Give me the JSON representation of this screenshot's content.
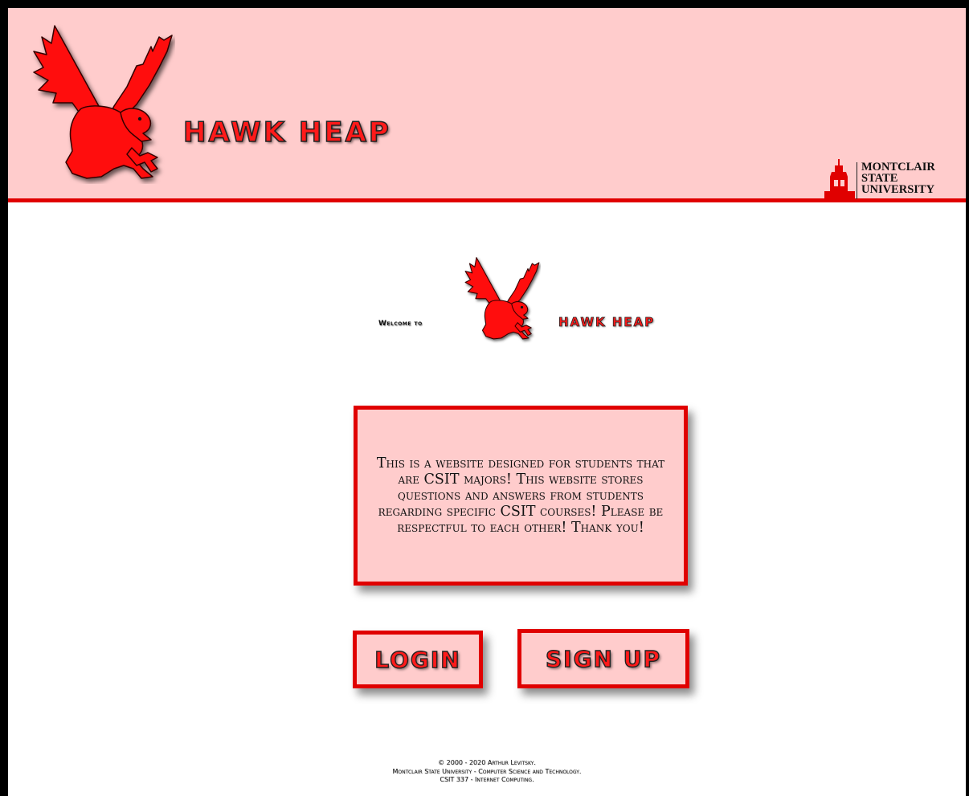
{
  "header": {
    "site_title": "HAWK HEAP",
    "university_logo": {
      "line1": "MONTCLAIR",
      "line2": "STATE",
      "line3": "UNIVERSITY"
    }
  },
  "welcome": {
    "prefix": "Welcome to",
    "site_title": "HAWK HEAP"
  },
  "info": {
    "text": "This is a website designed for students that are CSIT majors! This website stores questions and answers from students regarding specific CSIT courses! Please be respectful to each other! Thank you!"
  },
  "buttons": {
    "login_label": "LOGIN",
    "signup_label": "SIGN UP"
  },
  "footer": {
    "line1": "© 2000 - 2020 Arthur Levitsky.",
    "line2": "Montclair State University - Computer Science and Technology.",
    "line3": "CSIT 337 - Internet Computing."
  },
  "colors": {
    "accent_red": "#e00000",
    "header_bg": "#ffcccc",
    "frame": "#000000"
  },
  "icons": {
    "mascot": "red-hawk-icon",
    "university": "msu-tower-icon"
  }
}
